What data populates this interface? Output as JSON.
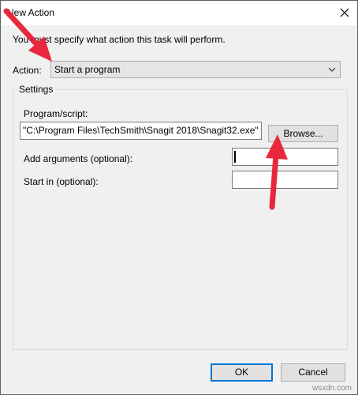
{
  "window": {
    "title": "New Action"
  },
  "instruction": "You must specify what action this task will perform.",
  "action": {
    "label": "Action:",
    "value": "Start a program"
  },
  "settings": {
    "legend": "Settings",
    "program_label": "Program/script:",
    "program_value": "\"C:\\Program Files\\TechSmith\\Snagit 2018\\Snagit32.exe\"",
    "browse_label": "Browse...",
    "args_label": "Add arguments (optional):",
    "args_value": "",
    "startin_label": "Start in (optional):",
    "startin_value": ""
  },
  "buttons": {
    "ok": "OK",
    "cancel": "Cancel"
  },
  "watermark": "wsxdn.com",
  "colors": {
    "arrow": "#e8283c",
    "focus": "#0078d7"
  },
  "icons": {
    "close": "close-icon",
    "dropdown": "chevron-down-icon"
  }
}
